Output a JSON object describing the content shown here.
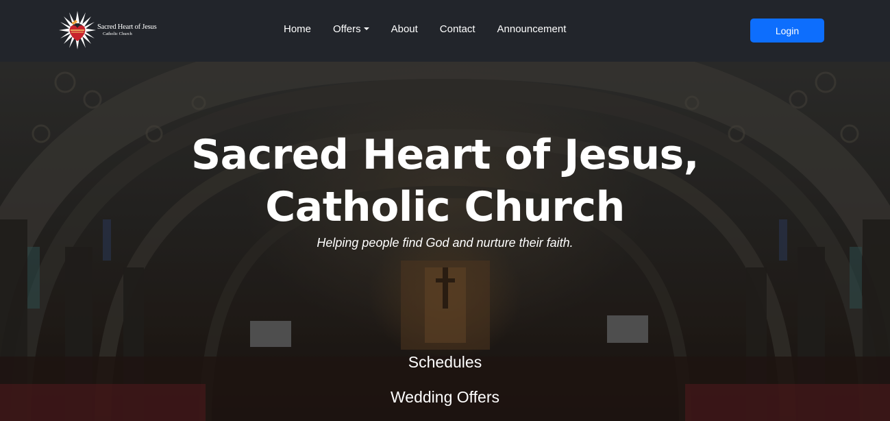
{
  "brand": {
    "name": "Sacred Heart of Jesus",
    "subtitle": "Catholic Church",
    "logo_icon": "sacred-heart-icon",
    "colors": {
      "heart": "#c8232c",
      "rays": "#ffffff",
      "flame": "#f2a33a"
    }
  },
  "nav": {
    "items": [
      {
        "label": "Home"
      },
      {
        "label": "Offers",
        "dropdown": true,
        "icon": "caret-down-icon"
      },
      {
        "label": "About"
      },
      {
        "label": "Contact"
      },
      {
        "label": "Announcement"
      }
    ],
    "login_label": "Login"
  },
  "hero": {
    "title_line1": "Sacred Heart of Jesus,",
    "title_line2": "Catholic Church",
    "subtitle": "Helping people find God and nurture their faith.",
    "links": [
      {
        "label": "Schedules"
      },
      {
        "label": "Wedding Offers"
      }
    ]
  },
  "colors": {
    "navbar_bg": "#22252b",
    "primary_button": "#0d6efd",
    "text": "#ffffff"
  }
}
